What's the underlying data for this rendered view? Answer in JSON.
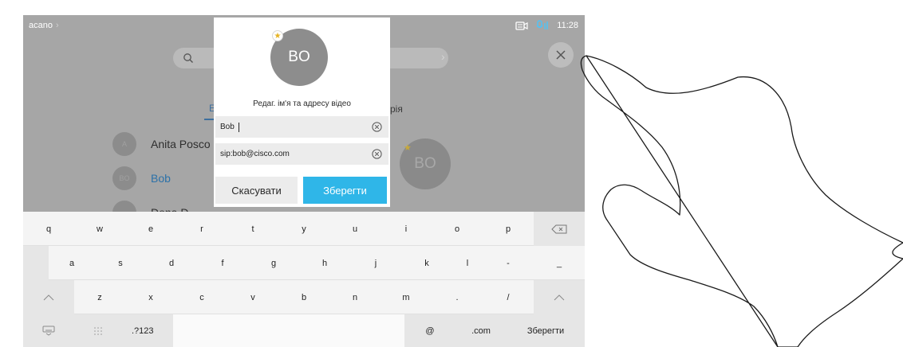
{
  "status_bar": {
    "breadcrumb": "acano",
    "breadcrumb_chevron": "›",
    "time": "11:28",
    "camera_icon": "camera-icon",
    "mic_icon": "microphone-icon"
  },
  "search": {
    "icon": "search-icon",
    "chevron": "›",
    "close_icon": "close-icon"
  },
  "tabs": {
    "left_fragment": "Е",
    "right_fragment": "рія"
  },
  "contacts": [
    {
      "initials": "A",
      "name": "Anita Posco",
      "selected": false
    },
    {
      "initials": "BO",
      "name": "Bob",
      "selected": true
    },
    {
      "initials": "",
      "name": "Dona D",
      "selected": false
    }
  ],
  "preview_avatar": {
    "initials": "BO"
  },
  "dialog": {
    "avatar_initials": "BO",
    "favorite_icon": "star-icon",
    "title": "Редаг. ім'я та адресу відео",
    "name_value": "Bob",
    "address_value": "sip:bob@cisco.com",
    "clear_icon": "clear-icon",
    "cancel_label": "Скасувати",
    "save_label": "Зберегти"
  },
  "keyboard": {
    "row1": [
      "q",
      "w",
      "e",
      "r",
      "t",
      "y",
      "u",
      "i",
      "o",
      "p"
    ],
    "row2": [
      "a",
      "s",
      "d",
      "f",
      "g",
      "h",
      "j",
      "k",
      "l",
      "-",
      "_"
    ],
    "row3": [
      "z",
      "x",
      "c",
      "v",
      "b",
      "n",
      "m",
      ".",
      "/"
    ],
    "numbers_label": ".?123",
    "at_label": "@",
    "com_label": ".com",
    "save_label": "Зберегти",
    "backspace_icon": "backspace-icon",
    "shift_icon": "shift-icon",
    "hide_keyboard_icon": "keyboard-hide-icon",
    "keypad_icon": "keypad-grid-icon"
  },
  "colors": {
    "accent": "#2fb6e8",
    "selected_text": "#2d72a8",
    "overlay_gray": "#a6a6a6",
    "keyboard_bg": "#f4f4f4"
  },
  "illustration": {
    "type": "hand-pointing-icon"
  }
}
